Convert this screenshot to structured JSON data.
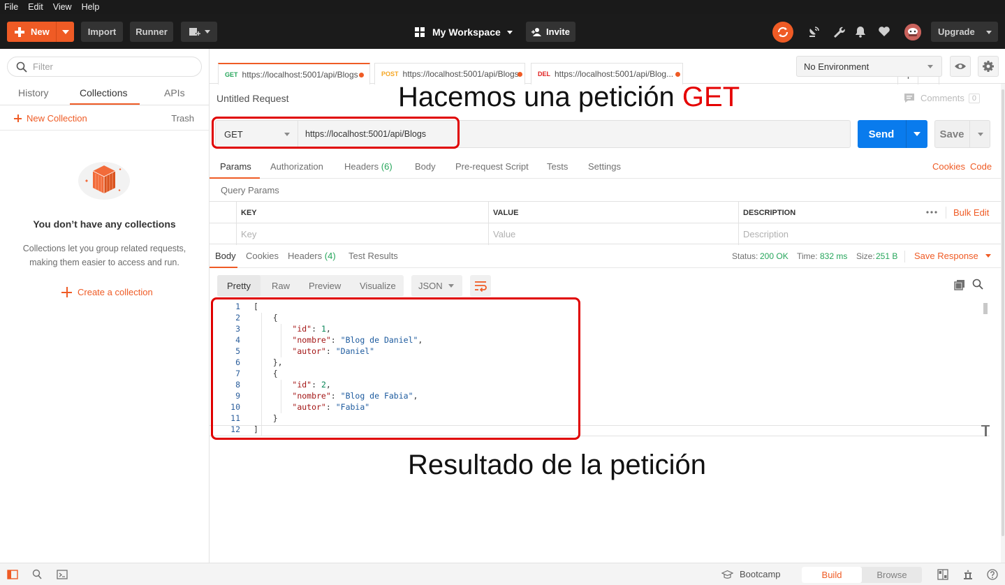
{
  "menu": [
    "File",
    "Edit",
    "View",
    "Help"
  ],
  "toolbar": {
    "new_label": "New",
    "import_label": "Import",
    "runner_label": "Runner",
    "workspace_label": "My Workspace",
    "invite_label": "Invite",
    "upgrade_label": "Upgrade"
  },
  "sidebar": {
    "filter_placeholder": "Filter",
    "tabs": [
      "History",
      "Collections",
      "APIs"
    ],
    "active_tab": "Collections",
    "new_collection": "New Collection",
    "trash": "Trash",
    "empty_title": "You don’t have any collections",
    "empty_desc": "Collections let you group related requests, making them easier to access and run.",
    "create_collection": "Create a collection"
  },
  "request_tabs": [
    {
      "method": "GET",
      "url": "https://localhost:5001/api/Blogs",
      "color": "#26a65b"
    },
    {
      "method": "POST",
      "url": "https://localhost:5001/api/Blogs",
      "color": "#f5a623"
    },
    {
      "method": "DEL",
      "url": "https://localhost:5001/api/Blog...",
      "color": "#e02020"
    }
  ],
  "environment": "No Environment",
  "request": {
    "title": "Untitled Request",
    "comments_label": "Comments",
    "comments_count": "0",
    "method": "GET",
    "url": "https://localhost:5001/api/Blogs",
    "send_label": "Send",
    "save_label": "Save"
  },
  "request_subtabs": {
    "params": "Params",
    "authorization": "Authorization",
    "headers": "Headers",
    "headers_count": "(6)",
    "body": "Body",
    "prerequest": "Pre-request Script",
    "tests": "Tests",
    "settings": "Settings",
    "cookies": "Cookies",
    "code": "Code"
  },
  "query_params": {
    "title": "Query Params",
    "columns": [
      "KEY",
      "VALUE",
      "DESCRIPTION"
    ],
    "placeholders": [
      "Key",
      "Value",
      "Description"
    ],
    "bulk_edit": "Bulk Edit"
  },
  "response": {
    "tabs": {
      "body": "Body",
      "cookies": "Cookies",
      "headers": "Headers",
      "headers_count": "(4)",
      "tests": "Test Results"
    },
    "status_label": "Status:",
    "status_value": "200 OK",
    "time_label": "Time:",
    "time_value": "832 ms",
    "size_label": "Size:",
    "size_value": "251 B",
    "save_response": "Save Response",
    "view_tabs": [
      "Pretty",
      "Raw",
      "Preview",
      "Visualize"
    ],
    "format": "JSON",
    "lines": [
      {
        "n": "1",
        "text": "["
      },
      {
        "n": "2",
        "text": "    {"
      },
      {
        "n": "3",
        "key": "\"id\"",
        "val": "1",
        "type": "num",
        "trail": ","
      },
      {
        "n": "4",
        "key": "\"nombre\"",
        "val": "\"Blog de Daniel\"",
        "type": "str",
        "trail": ","
      },
      {
        "n": "5",
        "key": "\"autor\"",
        "val": "\"Daniel\"",
        "type": "str",
        "trail": ""
      },
      {
        "n": "6",
        "text": "    },"
      },
      {
        "n": "7",
        "text": "    {"
      },
      {
        "n": "8",
        "key": "\"id\"",
        "val": "2",
        "type": "num",
        "trail": ","
      },
      {
        "n": "9",
        "key": "\"nombre\"",
        "val": "\"Blog de Fabia\"",
        "type": "str",
        "trail": ","
      },
      {
        "n": "10",
        "key": "\"autor\"",
        "val": "\"Fabia\"",
        "type": "str",
        "trail": ""
      },
      {
        "n": "11",
        "text": "    }"
      },
      {
        "n": "12",
        "text": "]"
      }
    ]
  },
  "annotations": {
    "top_prefix": "Hacemos una petición ",
    "top_highlight": "GET",
    "bottom": "Resultado de la petición"
  },
  "statusbar": {
    "bootcamp": "Bootcamp",
    "build": "Build",
    "browse": "Browse"
  }
}
